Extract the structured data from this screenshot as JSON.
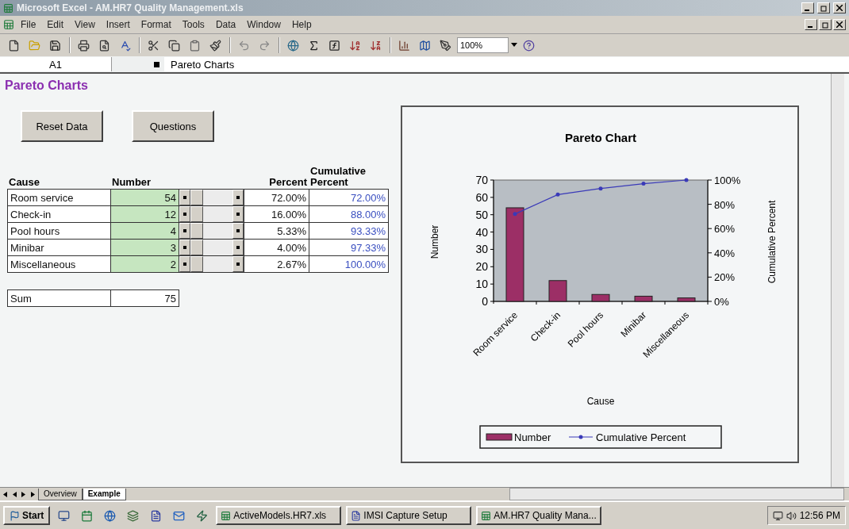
{
  "window": {
    "title": "Microsoft Excel - AM.HR7 Quality Management.xls"
  },
  "menu": [
    "File",
    "Edit",
    "View",
    "Insert",
    "Format",
    "Tools",
    "Data",
    "Window",
    "Help"
  ],
  "toolbar": {
    "zoom": "100%"
  },
  "formula_bar": {
    "name_box": "A1",
    "content": "Pareto Charts"
  },
  "sheet": {
    "heading": "Pareto Charts",
    "buttons": [
      "Reset Data",
      "Questions"
    ],
    "table": {
      "columns": [
        "Cause",
        "Number",
        "Percent",
        "Cumulative Percent"
      ],
      "rows": [
        {
          "cause": "Room service",
          "number": "54",
          "percent": "72.00%",
          "cumulative": "72.00%"
        },
        {
          "cause": "Check-in",
          "number": "12",
          "percent": "16.00%",
          "cumulative": "88.00%"
        },
        {
          "cause": "Pool hours",
          "number": "4",
          "percent": "5.33%",
          "cumulative": "93.33%"
        },
        {
          "cause": "Minibar",
          "number": "3",
          "percent": "4.00%",
          "cumulative": "97.33%"
        },
        {
          "cause": "Miscellaneous",
          "number": "2",
          "percent": "2.67%",
          "cumulative": "100.00%"
        }
      ]
    },
    "sum": {
      "label": "Sum",
      "value": "75"
    },
    "chart": {
      "chart_data": {
        "type": "bar",
        "title": "Pareto Chart",
        "xlabel": "Cause",
        "ylabel": "Number",
        "y2label": "Cumulative Percent",
        "categories": [
          "Room service",
          "Check-in",
          "Pool hours",
          "Minibar",
          "Miscellaneous"
        ],
        "series": [
          {
            "name": "Number",
            "color": "#9c2f66",
            "values": [
              54,
              12,
              4,
              3,
              2
            ]
          },
          {
            "name": "Cumulative Percent",
            "color": "#3a3ab8",
            "type": "line",
            "axis": "y2",
            "values": [
              72,
              88,
              93,
              97,
              100
            ]
          }
        ],
        "legend": "bottom",
        "ylim": [
          0,
          70
        ],
        "y2lim": [
          0,
          100
        ],
        "yticks": [
          0,
          10,
          20,
          30,
          40,
          50,
          60,
          70
        ],
        "y2ticks": [
          {
            "value": 0,
            "label": "0%"
          },
          {
            "value": 20,
            "label": "20%"
          },
          {
            "value": 40,
            "label": "40%"
          },
          {
            "value": 60,
            "label": "60%"
          },
          {
            "value": 80,
            "label": "80%"
          },
          {
            "value": 100,
            "label": "100%"
          }
        ]
      }
    }
  },
  "sheet_tabs": [
    {
      "label": "Overview",
      "selected": false
    },
    {
      "label": "Example",
      "selected": true
    }
  ],
  "taskbar": {
    "start": "Start",
    "tasks": [
      {
        "label": "ActiveModels.HR7.xls",
        "kind": "excel"
      },
      {
        "label": "IMSI Capture Setup",
        "kind": "word"
      },
      {
        "label": "AM.HR7 Quality Mana...",
        "kind": "excel"
      }
    ],
    "clock": "12:56 PM"
  }
}
